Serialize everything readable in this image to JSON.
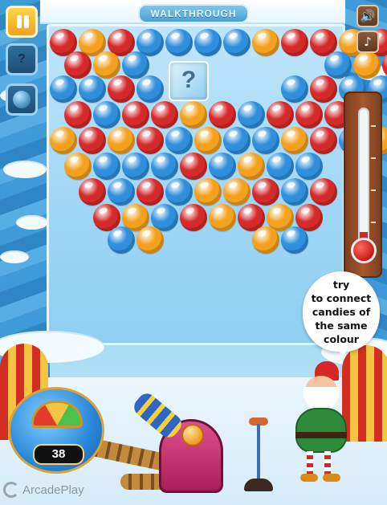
{
  "header": {
    "title": "WALKTHROUGH"
  },
  "controls": {
    "pause_icon": "pause-icon",
    "help_icon": "question-icon",
    "bubble_icon": "bubble-icon",
    "sound_icon": "speaker-icon",
    "music_icon": "music-note-icon",
    "sound_glyph": "🔊",
    "music_glyph": "♪"
  },
  "board": {
    "mystery_glyph": "?",
    "colors": {
      "red": "#d62a2a",
      "orange": "#f4a11e",
      "blue": "#2f8fdc"
    }
  },
  "shots": {
    "remaining": "38"
  },
  "thermometer": {
    "level_fraction": 0.08
  },
  "tip": {
    "lines": [
      "try",
      "to connect",
      "candies of",
      "the same",
      "colour"
    ]
  },
  "brand": {
    "logo_text": "ArcadePlay"
  }
}
